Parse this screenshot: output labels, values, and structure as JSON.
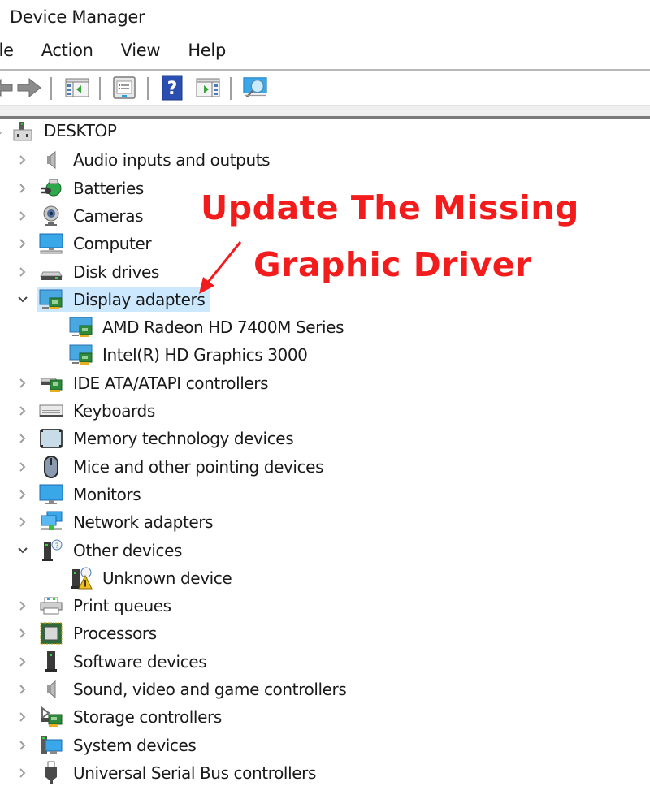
{
  "window": {
    "title": "Device Manager"
  },
  "menu": [
    "ile",
    "Action",
    "View",
    "Help"
  ],
  "toolbar": {
    "buttons": [
      "back-arrow-icon",
      "forward-arrow-icon",
      "show-hide-console-tree-icon",
      "properties-icon",
      "help-icon",
      "show-hide-action-pane-icon",
      "scan-hardware-changes-icon"
    ]
  },
  "tree": {
    "root": "DESKTOP",
    "categories": [
      {
        "label": "Audio inputs and outputs",
        "icon": "speaker-icon",
        "expanded": false
      },
      {
        "label": "Batteries",
        "icon": "battery-icon",
        "expanded": false
      },
      {
        "label": "Cameras",
        "icon": "webcam-icon",
        "expanded": false
      },
      {
        "label": "Computer",
        "icon": "computer-icon",
        "expanded": false
      },
      {
        "label": "Disk drives",
        "icon": "disk-drive-icon",
        "expanded": false
      },
      {
        "label": "Display adapters",
        "icon": "display-adapter-icon",
        "expanded": true,
        "selected": true,
        "children": [
          {
            "label": "AMD Radeon HD 7400M Series",
            "icon": "display-adapter-icon"
          },
          {
            "label": "Intel(R) HD Graphics 3000",
            "icon": "display-adapter-icon"
          }
        ]
      },
      {
        "label": "IDE ATA/ATAPI controllers",
        "icon": "ide-controller-icon",
        "expanded": false
      },
      {
        "label": "Keyboards",
        "icon": "keyboard-icon",
        "expanded": false
      },
      {
        "label": "Memory technology devices",
        "icon": "memory-device-icon",
        "expanded": false
      },
      {
        "label": "Mice and other pointing devices",
        "icon": "mouse-icon",
        "expanded": false
      },
      {
        "label": "Monitors",
        "icon": "monitor-icon",
        "expanded": false
      },
      {
        "label": "Network adapters",
        "icon": "network-adapter-icon",
        "expanded": false
      },
      {
        "label": "Other devices",
        "icon": "unknown-device-icon",
        "expanded": true,
        "children": [
          {
            "label": "Unknown device",
            "icon": "warning-device-icon"
          }
        ]
      },
      {
        "label": "Print queues",
        "icon": "printer-icon",
        "expanded": false
      },
      {
        "label": "Processors",
        "icon": "processor-icon",
        "expanded": false
      },
      {
        "label": "Software devices",
        "icon": "software-device-icon",
        "expanded": false
      },
      {
        "label": "Sound, video and game controllers",
        "icon": "speaker-icon",
        "expanded": false
      },
      {
        "label": "Storage controllers",
        "icon": "storage-controller-icon",
        "expanded": false
      },
      {
        "label": "System devices",
        "icon": "system-device-icon",
        "expanded": false
      },
      {
        "label": "Universal Serial Bus controllers",
        "icon": "usb-icon",
        "expanded": false
      }
    ]
  },
  "annotation": {
    "line1": "Update The Missing",
    "line2": "Graphic Driver",
    "color": "#f21c1c"
  }
}
